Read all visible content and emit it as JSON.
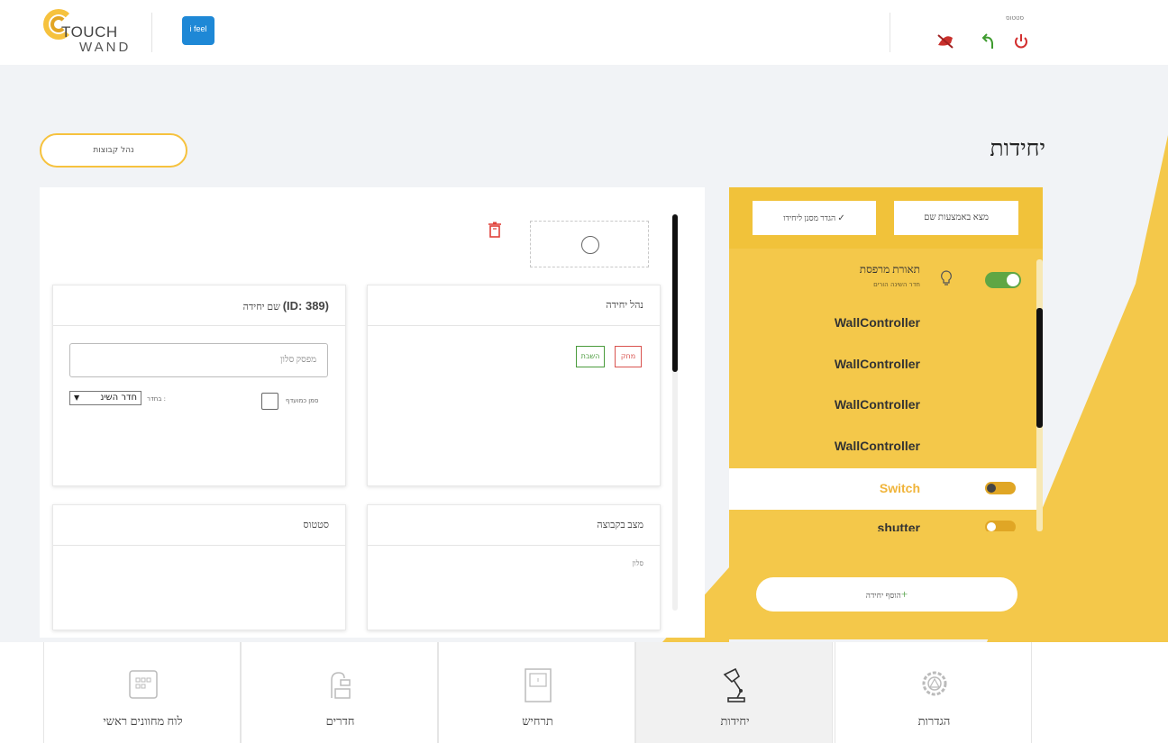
{
  "header": {
    "logo_line1": "TOUCH",
    "logo_line2": "WAND",
    "partner_logo": "i feel",
    "status_label": "סטטוס",
    "icons": [
      "alarm-off-icon",
      "undo-icon",
      "power-icon"
    ]
  },
  "page": {
    "title": "יחידות",
    "manage_groups_label": "נהל קבוצות"
  },
  "unit_editor": {
    "manage_card": {
      "title": "נהל יחידה",
      "delete_label": "מחק",
      "disable_label": "השבת"
    },
    "name_card": {
      "title_prefix": "שם יחידה ",
      "title_id": "(ID: 389)",
      "name_value": "מפסק סלון",
      "favorite_label": "סמן כמועדף",
      "room_label": "בחדר :",
      "room_value": "חדר השינ"
    },
    "group_card": {
      "title": "מצב בקבוצה",
      "value": "סלון"
    },
    "status_card": {
      "title": "סטטוס"
    }
  },
  "units_panel": {
    "find_label": "מצא באמצעות שם",
    "filter_label": "הגדר מסנן ליחידו",
    "add_label": "הוסף יחידה",
    "units": [
      {
        "name": "תאורת מרפסת",
        "room": "חדר השינה הורים",
        "state": "on"
      },
      {
        "name": "WallController"
      },
      {
        "name": "WallController"
      },
      {
        "name": "WallController"
      },
      {
        "name": "WallController"
      },
      {
        "name": "Switch",
        "selected": true
      },
      {
        "name": "shutter"
      }
    ]
  },
  "bottom_nav": {
    "tabs": [
      {
        "label": "לוח מחוונים ראשי",
        "icon": "dashboard-icon"
      },
      {
        "label": "חדרים",
        "icon": "rooms-icon"
      },
      {
        "label": "תרחיש",
        "icon": "scenario-icon"
      },
      {
        "label": "יחידות",
        "icon": "lamp-icon",
        "active": true
      },
      {
        "label": "הגדרות",
        "icon": "gear-icon"
      }
    ]
  },
  "colors": {
    "accent_yellow": "#f4c84a",
    "toggle_green": "#5fa644",
    "danger_red": "#d9534f",
    "success_green": "#4a9b3c",
    "switch_text": "#f0b43a"
  }
}
